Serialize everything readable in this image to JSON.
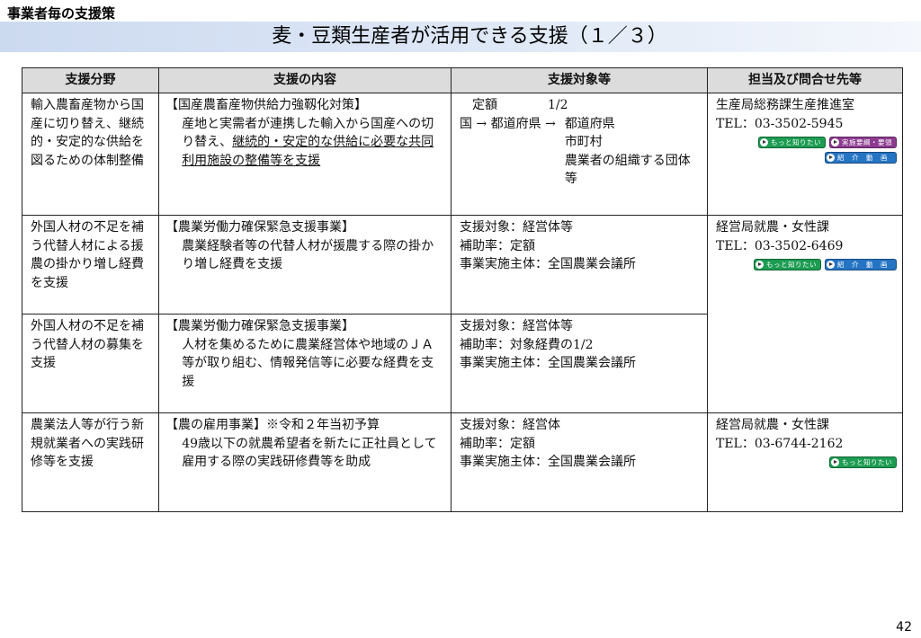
{
  "header": {
    "section_label": "事業者毎の支援策",
    "title": "麦・豆類生産者が活用できる支援（１／３）"
  },
  "table": {
    "columns": [
      "支援分野",
      "支援の内容",
      "支援対象等",
      "担当及び問合せ先等"
    ],
    "rows": [
      {
        "field": "輸入農畜産物から国産に切り替え、継続的・安定的な供給を図るための体制整備",
        "content_title": "【国産農畜産物供給力強靱化対策】",
        "content_body_plain": "産地と実需者が連携した輸入から国産への切り替え、",
        "content_body_underlined": "継続的・安定的な供給に必要な共同利用施設の整備等を支援",
        "target_rate": "　定額　　　　1/2",
        "target_flow_from": "国 → 都道府県 →",
        "target_flow_to": [
          "都道府県",
          "市町村",
          "農業者の組織する団体　等"
        ],
        "contact_dept": "生産局総務課生産推進室",
        "contact_tel": "TEL：03-3502-5945",
        "buttons": [
          {
            "label": "もっと知りたい",
            "color": "#1d9c52"
          },
          {
            "label": "実施要綱・要領",
            "color": "#8c3b8f"
          },
          {
            "label": "紹　介　動　画",
            "color": "#2574c4"
          }
        ]
      },
      {
        "field": "外国人材の不足を補う代替人材による援農の掛かり増し経費を支援",
        "content_title": "【農業労働力確保緊急支援事業】",
        "content_body": "農業経験者等の代替人材が援農する際の掛かり増し経費を支援",
        "target_lines": [
          "支援対象：経営体等",
          "補助率：定額",
          "事業実施主体：全国農業会議所"
        ],
        "contact_dept": "経営局就農・女性課",
        "contact_tel": "TEL：03-3502-6469",
        "buttons": [
          {
            "label": "もっと知りたい",
            "color": "#1d9c52"
          },
          {
            "label": "紹　介　動　画",
            "color": "#2574c4"
          }
        ]
      },
      {
        "field": "外国人材の不足を補う代替人材の募集を支援",
        "content_title": "【農業労働力確保緊急支援事業】",
        "content_body": "人材を集めるために農業経営体や地域のＪＡ等が取り組む、情報発信等に必要な経費を支援",
        "target_lines": [
          "支援対象：経営体等",
          "補助率：対象経費の1/2",
          "事業実施主体：全国農業会議所"
        ]
      },
      {
        "field": "農業法人等が行う新規就業者への実践研修等を支援",
        "content_title": "【農の雇用事業】※令和２年当初予算",
        "content_body": "49歳以下の就農希望者を新たに正社員として雇用する際の実践研修費等を助成",
        "target_lines": [
          "支援対象：経営体",
          "補助率：定額",
          "事業実施主体：全国農業会議所"
        ],
        "contact_dept": "経営局就農・女性課",
        "contact_tel": "TEL：03-6744-2162",
        "buttons": [
          {
            "label": "もっと知りたい",
            "color": "#1d9c52"
          }
        ]
      }
    ]
  },
  "page_number": "42"
}
